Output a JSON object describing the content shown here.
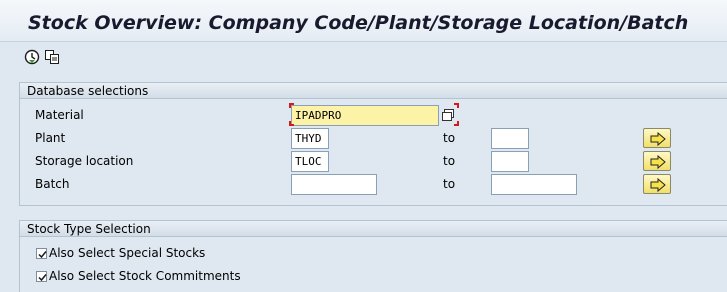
{
  "title": "Stock Overview: Company Code/Plant/Storage Location/Batch",
  "toolbar": {
    "icons": [
      "execute-icon",
      "copy-selection-icon"
    ]
  },
  "db_selections": {
    "header": "Database selections",
    "material": {
      "label": "Material",
      "value": "IPADPRO"
    },
    "plant": {
      "label": "Plant",
      "from": "THYD",
      "to_label": "to",
      "to": ""
    },
    "storage_location": {
      "label": "Storage location",
      "from": "TLOC",
      "to_label": "to",
      "to": ""
    },
    "batch": {
      "label": "Batch",
      "from": "",
      "to_label": "to",
      "to": ""
    }
  },
  "stock_type": {
    "header": "Stock Type Selection",
    "special_stocks": {
      "label": "Also Select Special Stocks",
      "checked": true
    },
    "stock_commitments": {
      "label": "Also Select Stock Commitments",
      "checked": true
    }
  }
}
